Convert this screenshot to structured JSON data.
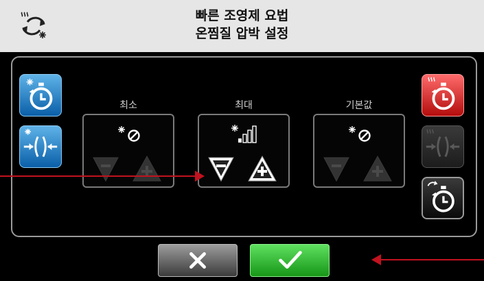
{
  "header": {
    "title_line1": "빠른 조영제 요법",
    "title_line2": "온찜질 압박 설정",
    "mode_icon": "heat-cold-cycle-icon"
  },
  "left_buttons": [
    {
      "icon": "cold-timer-icon",
      "color": "#1a7fd0"
    },
    {
      "icon": "cold-compression-icon",
      "color": "#1a7fd0"
    }
  ],
  "right_buttons": [
    {
      "icon": "heat-timer-icon",
      "color": "#e01b1b"
    },
    {
      "icon": "heat-compression-icon",
      "state": "disabled"
    },
    {
      "icon": "cycle-timer-icon"
    }
  ],
  "columns": [
    {
      "label": "최소",
      "icon": "no-compression-icon",
      "active": false
    },
    {
      "label": "최대",
      "icon": "compression-level-icon",
      "active": true
    },
    {
      "label": "기본값",
      "icon": "no-compression-icon",
      "active": false
    }
  ],
  "footer": {
    "cancel_icon": "x-icon",
    "confirm_icon": "checkmark-icon"
  },
  "colors": {
    "pointer": "#c1121f",
    "confirm": "#2dbb2d",
    "header_bg": "#e6e6e6"
  }
}
